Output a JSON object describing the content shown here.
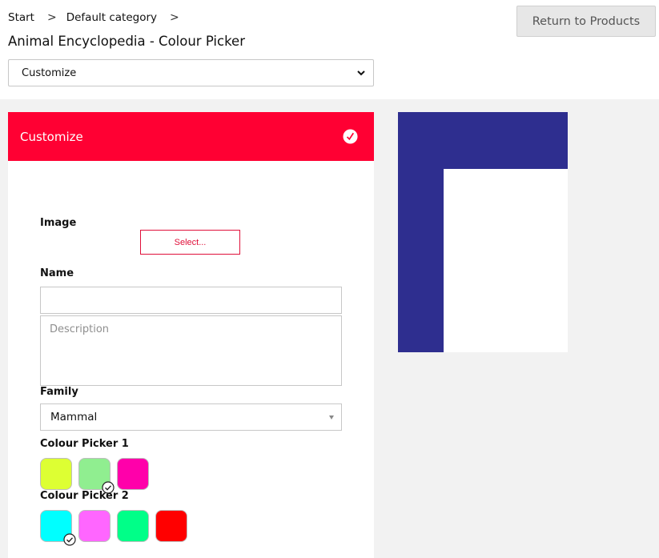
{
  "breadcrumb": {
    "items": [
      "Start",
      "Default category"
    ]
  },
  "page_title": "Animal Encyclopedia - Colour Picker",
  "return_button": "Return to Products",
  "top_select": {
    "value": "Customize"
  },
  "panel": {
    "header": "Customize",
    "header_bg": "#ff0033",
    "image_label": "Image",
    "select_button": "Select...",
    "name_label": "Name",
    "name_value": "",
    "description_placeholder": "Description",
    "family_label": "Family",
    "family_value": "Mammal",
    "colour_picker_1": {
      "label": "Colour Picker 1",
      "swatches": [
        "#ddff33",
        "#90ee90",
        "#ff00aa"
      ],
      "selected_index": 1
    },
    "colour_picker_2": {
      "label": "Colour Picker 2",
      "swatches": [
        "#00ffff",
        "#ff66ff",
        "#00ff88",
        "#ff0000"
      ],
      "selected_index": 0
    }
  },
  "preview": {
    "outer_color": "#2e2e8f",
    "inner_color": "#ffffff"
  }
}
